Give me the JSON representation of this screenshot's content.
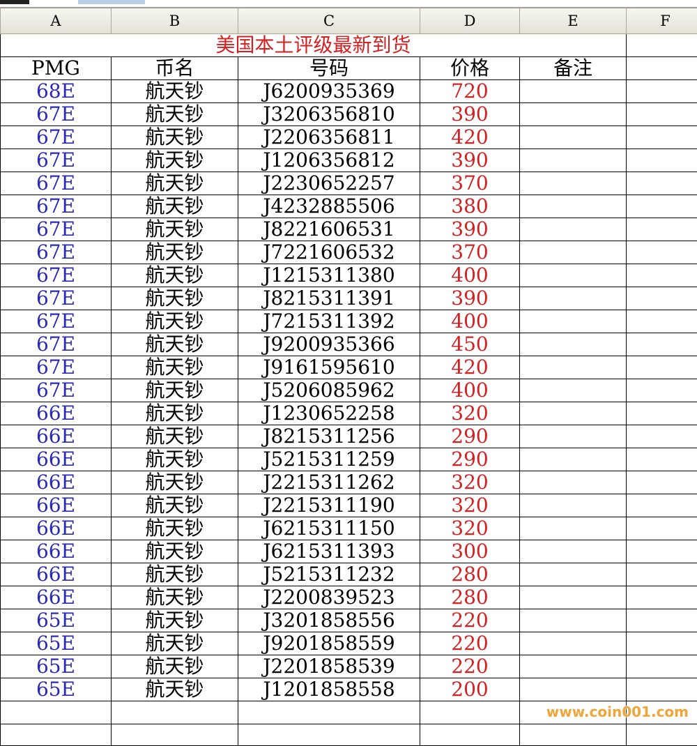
{
  "columns": [
    "A",
    "B",
    "C",
    "D",
    "E",
    "F"
  ],
  "title": "美国本土评级最新到货",
  "headers": {
    "pmg": "PMG",
    "name": "币名",
    "serial": "号码",
    "price": "价格",
    "note": "备注"
  },
  "rows": [
    {
      "grade": "68E",
      "name": "航天钞",
      "serial": "J6200935369",
      "price": "720"
    },
    {
      "grade": "67E",
      "name": "航天钞",
      "serial": "J3206356810",
      "price": "390"
    },
    {
      "grade": "67E",
      "name": "航天钞",
      "serial": "J2206356811",
      "price": "420"
    },
    {
      "grade": "67E",
      "name": "航天钞",
      "serial": "J1206356812",
      "price": "390"
    },
    {
      "grade": "67E",
      "name": "航天钞",
      "serial": "J2230652257",
      "price": "370"
    },
    {
      "grade": "67E",
      "name": "航天钞",
      "serial": "J4232885506",
      "price": "380"
    },
    {
      "grade": "67E",
      "name": "航天钞",
      "serial": "J8221606531",
      "price": "390"
    },
    {
      "grade": "67E",
      "name": "航天钞",
      "serial": "J7221606532",
      "price": "370"
    },
    {
      "grade": "67E",
      "name": "航天钞",
      "serial": "J1215311380",
      "price": "400"
    },
    {
      "grade": "67E",
      "name": "航天钞",
      "serial": "J8215311391",
      "price": "390"
    },
    {
      "grade": "67E",
      "name": "航天钞",
      "serial": "J7215311392",
      "price": "400"
    },
    {
      "grade": "67E",
      "name": "航天钞",
      "serial": "J9200935366",
      "price": "450"
    },
    {
      "grade": "67E",
      "name": "航天钞",
      "serial": "J9161595610",
      "price": "420"
    },
    {
      "grade": "67E",
      "name": "航天钞",
      "serial": "J5206085962",
      "price": "400"
    },
    {
      "grade": "66E",
      "name": "航天钞",
      "serial": "J1230652258",
      "price": "320"
    },
    {
      "grade": "66E",
      "name": "航天钞",
      "serial": "J8215311256",
      "price": "290"
    },
    {
      "grade": "66E",
      "name": "航天钞",
      "serial": "J5215311259",
      "price": "290"
    },
    {
      "grade": "66E",
      "name": "航天钞",
      "serial": "J2215311262",
      "price": "320"
    },
    {
      "grade": "66E",
      "name": "航天钞",
      "serial": "J2215311190",
      "price": "320"
    },
    {
      "grade": "66E",
      "name": "航天钞",
      "serial": "J6215311150",
      "price": "320"
    },
    {
      "grade": "66E",
      "name": "航天钞",
      "serial": "J6215311393",
      "price": "300"
    },
    {
      "grade": "66E",
      "name": "航天钞",
      "serial": "J5215311232",
      "price": "280"
    },
    {
      "grade": "66E",
      "name": "航天钞",
      "serial": "J2200839523",
      "price": "280"
    },
    {
      "grade": "65E",
      "name": "航天钞",
      "serial": "J3201858556",
      "price": "220"
    },
    {
      "grade": "65E",
      "name": "航天钞",
      "serial": "J9201858559",
      "price": "220"
    },
    {
      "grade": "65E",
      "name": "航天钞",
      "serial": "J2201858539",
      "price": "220"
    },
    {
      "grade": "65E",
      "name": "航天钞",
      "serial": "J1201858558",
      "price": "200"
    }
  ],
  "watermark": "www.coin001.com",
  "colors": {
    "grade": "#2a2ab8",
    "price": "#d42020",
    "title": "#d42020",
    "watermark": "#f0a53a"
  }
}
